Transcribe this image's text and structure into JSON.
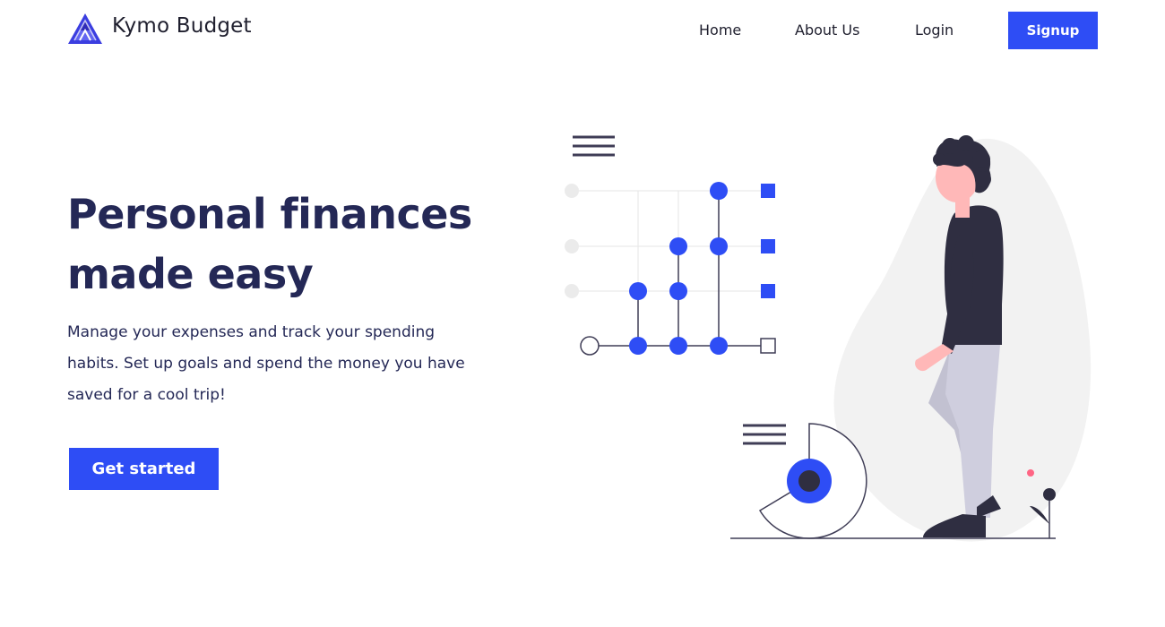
{
  "header": {
    "brand_name": "Kymo Budget",
    "logo_icon": "triangle-logo-icon",
    "nav": {
      "home": "Home",
      "about": "About Us",
      "login": "Login",
      "signup": "Signup"
    }
  },
  "hero": {
    "title_line1": "Personal finances",
    "title_line2": "made easy",
    "description": "Manage your expenses and track your spending habits. Set up goals and spend the money you have saved for a cool trip!",
    "cta_label": "Get started"
  },
  "illustration": {
    "name": "person-with-charts-illustration"
  },
  "colors": {
    "accent": "#2e4df5",
    "heading": "#242856",
    "text": "#1f1f2e",
    "illustration_dark": "#2f2e41",
    "illustration_light": "#f2f2f2",
    "pants": "#cbcbdb",
    "skin": "#ffb8b8",
    "flower": "#ff6584"
  }
}
